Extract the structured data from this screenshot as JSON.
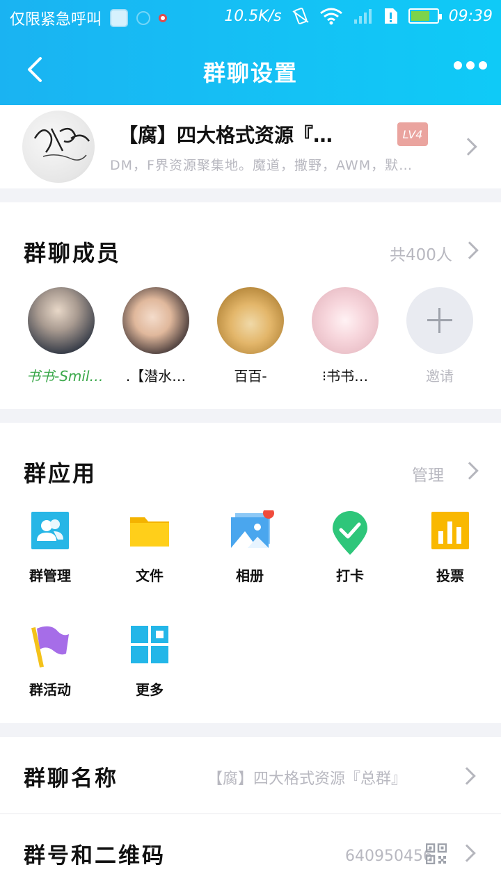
{
  "status_bar": {
    "carrier": "仅限紧急呼叫",
    "speed": "10.5K/s",
    "time": "09:39"
  },
  "nav": {
    "title": "群聊设置"
  },
  "group": {
    "name": "【腐】四大格式资源『…",
    "level": "LV4",
    "description": "DM，F界资源聚集地。魔道，撒野，AWM，默…"
  },
  "members": {
    "title": "群聊成员",
    "count": "共400人",
    "list": [
      {
        "name": "书书-Smil…"
      },
      {
        "name": ".【潜水…"
      },
      {
        "name": "百百-"
      },
      {
        "name": "⁝书书…"
      }
    ],
    "invite_label": "邀请"
  },
  "apps": {
    "title": "群应用",
    "manage_label": "管理",
    "items": [
      {
        "label": "群管理",
        "icon": "group-manage-icon"
      },
      {
        "label": "文件",
        "icon": "folder-icon"
      },
      {
        "label": "相册",
        "icon": "photo-album-icon"
      },
      {
        "label": "打卡",
        "icon": "checkin-icon"
      },
      {
        "label": "投票",
        "icon": "vote-icon"
      },
      {
        "label": "群活动",
        "icon": "flag-icon"
      },
      {
        "label": "更多",
        "icon": "grid-more-icon"
      }
    ]
  },
  "settings": {
    "group_name_label": "群聊名称",
    "group_name_value": "【腐】四大格式资源『总群』",
    "group_id_label": "群号和二维码",
    "group_id_value": "640950456"
  },
  "colors": {
    "header": "#14c2f5",
    "accent": "#1aa8f0",
    "badge": "#eaa49f"
  }
}
